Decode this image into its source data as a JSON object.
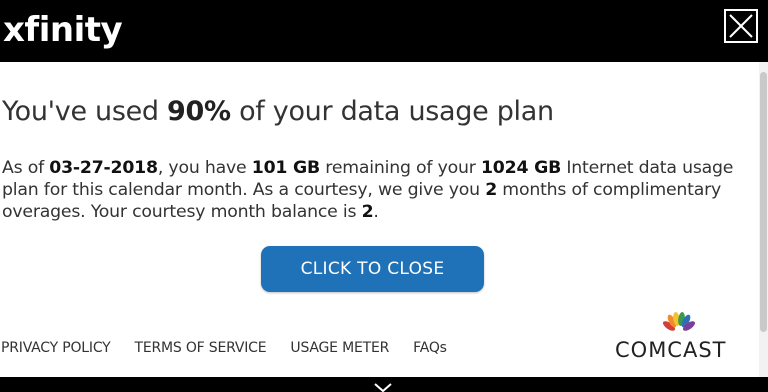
{
  "header": {
    "brand": "xfinity",
    "trademark": ".",
    "close_icon": "close-icon"
  },
  "message": {
    "headline_prefix": "You've used ",
    "headline_percent": "90%",
    "headline_suffix": " of your data usage plan",
    "t1": "As of ",
    "date": "03-27-2018",
    "t2": ", you have ",
    "remaining": "101 GB",
    "t3": " remaining of your ",
    "plan": "1024 GB",
    "t4": " Internet data usage plan for this calendar month. As a courtesy, we give you ",
    "courtesy_months": "2",
    "t5": " months of complimentary overages. Your courtesy month balance is ",
    "balance": "2",
    "t6": "."
  },
  "cta": {
    "label": "CLICK TO CLOSE"
  },
  "footer": {
    "links": [
      "PRIVACY POLICY",
      "TERMS OF SERVICE",
      "USAGE METER",
      "FAQs"
    ],
    "company": "COMCAST"
  },
  "colors": {
    "header_bg": "#000000",
    "button_bg": "#1f72b8",
    "text": "#333333"
  },
  "icons": {
    "close": "close-icon",
    "peacock": "peacock-logo-icon",
    "bottom": "chevron-down-icon"
  }
}
